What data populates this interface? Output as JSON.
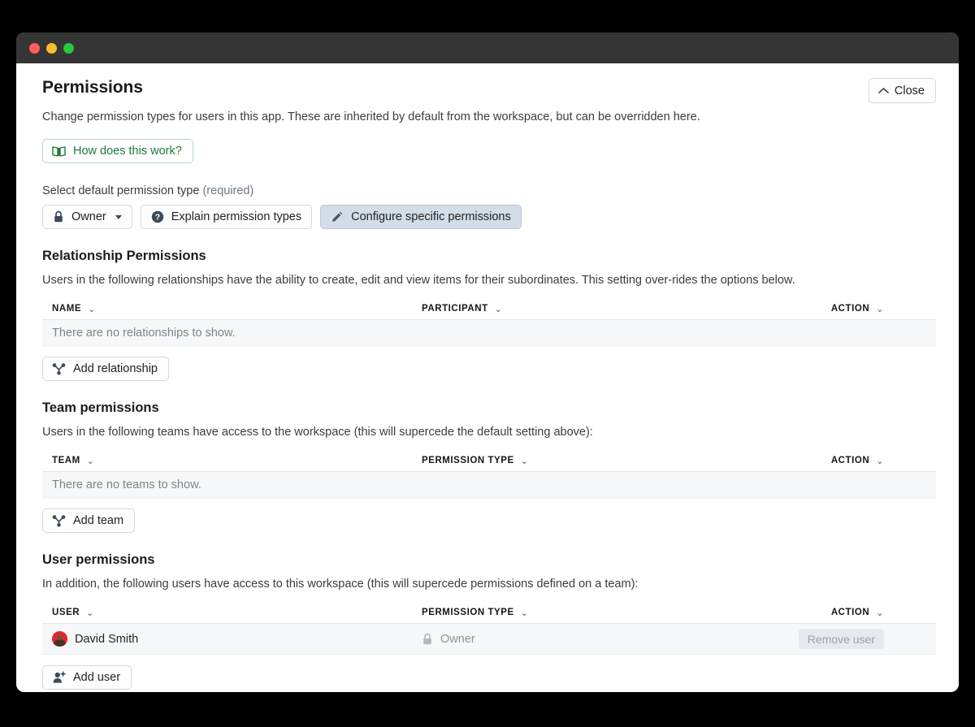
{
  "window": {
    "traffic_lights": [
      "close",
      "minimize",
      "zoom"
    ],
    "colors": {
      "red": "#ff5f57",
      "yellow": "#febc2e",
      "green": "#28c840",
      "titlebar": "#353535",
      "accent_green": "#1f7a3d",
      "active_button": "#d3dde8",
      "avatar_red": "#e8232b"
    }
  },
  "header": {
    "title": "Permissions",
    "description": "Change permission types for users in this app. These are inherited by default from the workspace, but can be overridden here.",
    "close_label": "Close",
    "close_icon": "chevron-up-icon"
  },
  "help": {
    "label": "How does this work?",
    "icon": "book-icon"
  },
  "default_permission": {
    "label": "Select default permission type",
    "required_text": "(required)",
    "selected_value": "Owner",
    "selected_icon": "lock-icon",
    "explain_label": "Explain permission types",
    "explain_icon": "question-circle-icon",
    "configure_label": "Configure specific permissions",
    "configure_icon": "pencil-icon",
    "configure_active": true
  },
  "relationship_section": {
    "heading": "Relationship Permissions",
    "description": "Users in the following relationships have the ability to create, edit and view items for their subordinates. This setting over-rides the options below.",
    "columns": [
      "NAME",
      "PARTICIPANT",
      "ACTION"
    ],
    "empty_text": "There are no relationships to show.",
    "rows": [],
    "add_label": "Add relationship",
    "add_icon": "hierarchy-icon"
  },
  "team_section": {
    "heading": "Team permissions",
    "description": "Users in the following teams have access to the workspace (this will supercede the default setting above):",
    "columns": [
      "TEAM",
      "PERMISSION TYPE",
      "ACTION"
    ],
    "empty_text": "There are no teams to show.",
    "rows": [],
    "add_label": "Add team",
    "add_icon": "hierarchy-icon"
  },
  "user_section": {
    "heading": "User permissions",
    "description": "In addition, the following users have access to this workspace (this will supercede permissions defined on a team):",
    "columns": [
      "USER",
      "PERMISSION TYPE",
      "ACTION"
    ],
    "rows": [
      {
        "user": "David Smith",
        "avatar": "user-photo-avatar",
        "permission_type": "Owner",
        "permission_icon": "lock-icon",
        "action_label": "Remove user",
        "action_disabled": true
      }
    ],
    "add_label": "Add user",
    "add_icon": "add-user-icon"
  },
  "sort_chevron": "⌄"
}
